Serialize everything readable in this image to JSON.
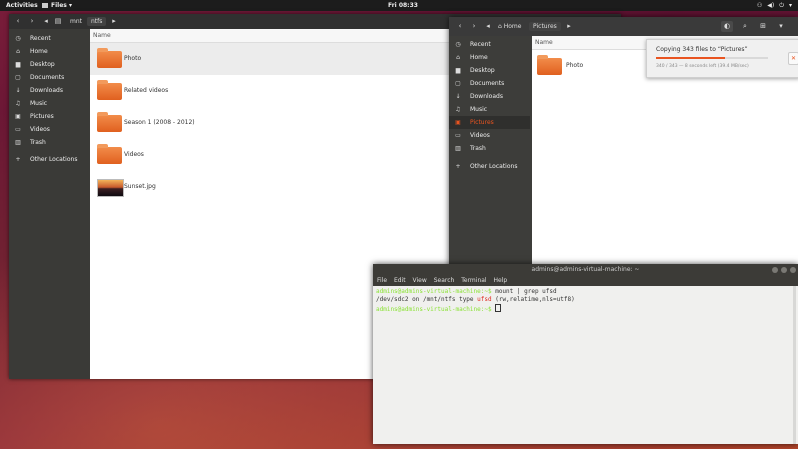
{
  "topbar": {
    "activities": "Activities",
    "app_menu": "Files ▾",
    "clock": "Fri 08:33",
    "status_icons": [
      "network-icon",
      "volume-icon",
      "power-icon",
      "menu-caret-icon"
    ]
  },
  "files_window_1": {
    "path": [
      "mnt",
      "ntfs"
    ],
    "sidebar": [
      {
        "icon": "◷",
        "label": "Recent"
      },
      {
        "icon": "⌂",
        "label": "Home"
      },
      {
        "icon": "▆",
        "label": "Desktop"
      },
      {
        "icon": "▢",
        "label": "Documents"
      },
      {
        "icon": "↓",
        "label": "Downloads"
      },
      {
        "icon": "♫",
        "label": "Music"
      },
      {
        "icon": "▣",
        "label": "Pictures"
      },
      {
        "icon": "▭",
        "label": "Videos"
      },
      {
        "icon": "▥",
        "label": "Trash"
      },
      {
        "icon": "+",
        "label": "Other Locations"
      }
    ],
    "column_name": "Name",
    "items": [
      {
        "name": "Photo",
        "type": "folder"
      },
      {
        "name": "Related videos",
        "type": "folder"
      },
      {
        "name": "Season 1 (2008 - 2012)",
        "type": "folder"
      },
      {
        "name": "Videos",
        "type": "folder"
      },
      {
        "name": "Sunset.jpg",
        "type": "image"
      }
    ]
  },
  "files_window_2": {
    "path_home": "Home",
    "path_current": "Pictures",
    "sidebar": [
      {
        "icon": "◷",
        "label": "Recent"
      },
      {
        "icon": "⌂",
        "label": "Home"
      },
      {
        "icon": "▆",
        "label": "Desktop"
      },
      {
        "icon": "▢",
        "label": "Documents"
      },
      {
        "icon": "↓",
        "label": "Downloads"
      },
      {
        "icon": "♫",
        "label": "Music"
      },
      {
        "icon": "▣",
        "label": "Pictures"
      },
      {
        "icon": "▭",
        "label": "Videos"
      },
      {
        "icon": "▥",
        "label": "Trash"
      },
      {
        "icon": "+",
        "label": "Other Locations"
      }
    ],
    "column_name": "Name",
    "items": [
      {
        "name": "Photo",
        "type": "folder"
      }
    ]
  },
  "progress": {
    "title": "Copying 343 files to “Pictures”",
    "subtitle": "340 / 343 — 8 seconds left (39.4 MB/sec)",
    "fraction": 0.62,
    "cancel": "✕"
  },
  "terminal": {
    "title": "admins@admins-virtual-machine: ~",
    "menu": [
      "File",
      "Edit",
      "View",
      "Search",
      "Terminal",
      "Help"
    ],
    "prompt": "admins@admins-virtual-machine:~$",
    "line1_cmd": " mount | grep ufsd",
    "line2_a": "/dev/sdc2 on /mnt/ntfs type ",
    "line2_hl": "ufsd",
    "line2_b": " (rw,relatime,nls=utf8)"
  },
  "colors": {
    "accent": "#e95420",
    "prompt": "#8ae234",
    "highlight": "#e0281e"
  }
}
